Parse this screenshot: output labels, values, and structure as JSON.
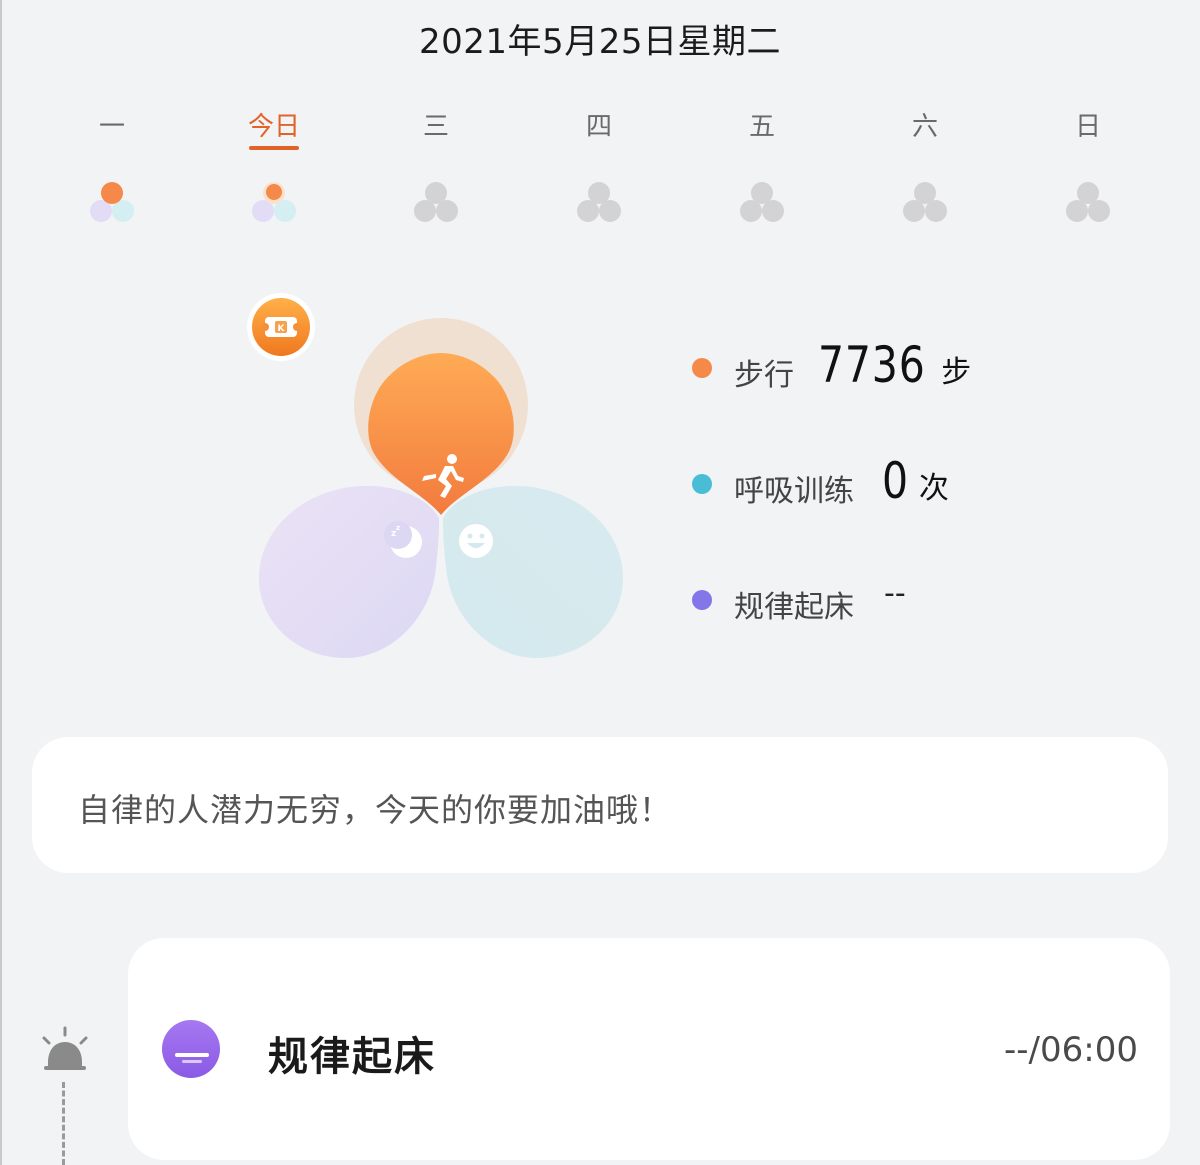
{
  "header": {
    "date_title": "2021年5月25日星期二"
  },
  "week": {
    "days": [
      {
        "label": "一",
        "state": "partial"
      },
      {
        "label": "今日",
        "state": "today"
      },
      {
        "label": "三",
        "state": "empty"
      },
      {
        "label": "四",
        "state": "empty"
      },
      {
        "label": "五",
        "state": "empty"
      },
      {
        "label": "六",
        "state": "empty"
      },
      {
        "label": "日",
        "state": "empty"
      }
    ]
  },
  "summary": {
    "badge_icon": "ticket-icon",
    "stats": [
      {
        "label": "步行",
        "value": "7736",
        "unit": "步",
        "color": "#f5894a"
      },
      {
        "label": "呼吸训练",
        "value": "0",
        "unit": "次",
        "color": "#49bcd6"
      },
      {
        "label": "规律起床",
        "value": "--",
        "unit": "",
        "color": "#8276e8"
      }
    ]
  },
  "colors": {
    "accent": "#e2632a",
    "background": "#f2f3f5",
    "orange": "#f5894a",
    "teal": "#49bcd6",
    "purple": "#8276e8"
  },
  "quote": {
    "text": "自律的人潜力无穷，今天的你要加油哦！"
  },
  "tasks": [
    {
      "title": "规律起床",
      "time": "--/06:00",
      "icon": "wake-up-icon",
      "timeline_icon": "alarm-bell-icon"
    }
  ]
}
